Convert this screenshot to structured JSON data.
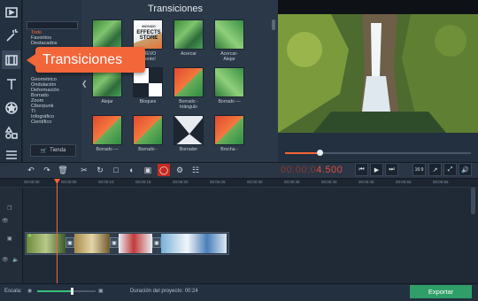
{
  "sidebar_tools": [
    "media-import-icon",
    "magic-wand-icon",
    "transitions-icon",
    "text-icon",
    "stickers-icon",
    "shapes-icon",
    "more-icon"
  ],
  "categories": {
    "items_top": [
      "Todo",
      "Favoritos",
      "Destacados"
    ],
    "items_bottom": [
      "Geométrico",
      "Ondulación",
      "Deformación",
      "Borrado",
      "Zoom",
      "Ciberpunk",
      "TI",
      "Infográfico",
      "Científico"
    ],
    "store_label": "Tienda"
  },
  "tooltip": "Transiciones",
  "grid": {
    "title": "Transiciones",
    "tiles": [
      {
        "label": "",
        "style": "fern"
      },
      {
        "label": "NUEVO\nEvento!",
        "style": "dark"
      },
      {
        "label": "Acercar",
        "style": "fern"
      },
      {
        "label": "Acercar-\nAlejar",
        "style": "fern2"
      },
      {
        "label": "Alejar",
        "style": "fern"
      },
      {
        "label": "Bloques",
        "style": "dark"
      },
      {
        "label": "Borrado -\ntriángulo",
        "style": "redfern"
      },
      {
        "label": "Borrado —",
        "style": "fern2"
      },
      {
        "label": "Borrado —",
        "style": "redfern"
      },
      {
        "label": "Borrado -",
        "style": "redfern"
      },
      {
        "label": "Borrader",
        "style": "dark"
      },
      {
        "label": "Brocha -",
        "style": "redfern"
      }
    ],
    "store_tile": {
      "line1": "MOVAVI",
      "line2": "EFFECTS",
      "line3": "STORE"
    }
  },
  "player": {
    "timecode_dim": "00:00:0",
    "timecode": "4.500",
    "aspect": "16:9"
  },
  "ruler_ticks": [
    "00:00:00",
    "00:00:05",
    "00:00:10",
    "00:00:15",
    "00:00:20",
    "00:00:25",
    "00:00:30",
    "00:00:35",
    "00:00:40",
    "00:00:45",
    "00:00:50",
    "00:00:55"
  ],
  "playback_progress": 0.19,
  "footer": {
    "scale_label": "Escala:",
    "scale_value": 0.6,
    "duration": "Duración del proyecto:  00:24",
    "export_label": "Exportar"
  },
  "colors": {
    "accent": "#f3663a",
    "export": "#2f9e68",
    "timecode": "#e24c3a"
  }
}
